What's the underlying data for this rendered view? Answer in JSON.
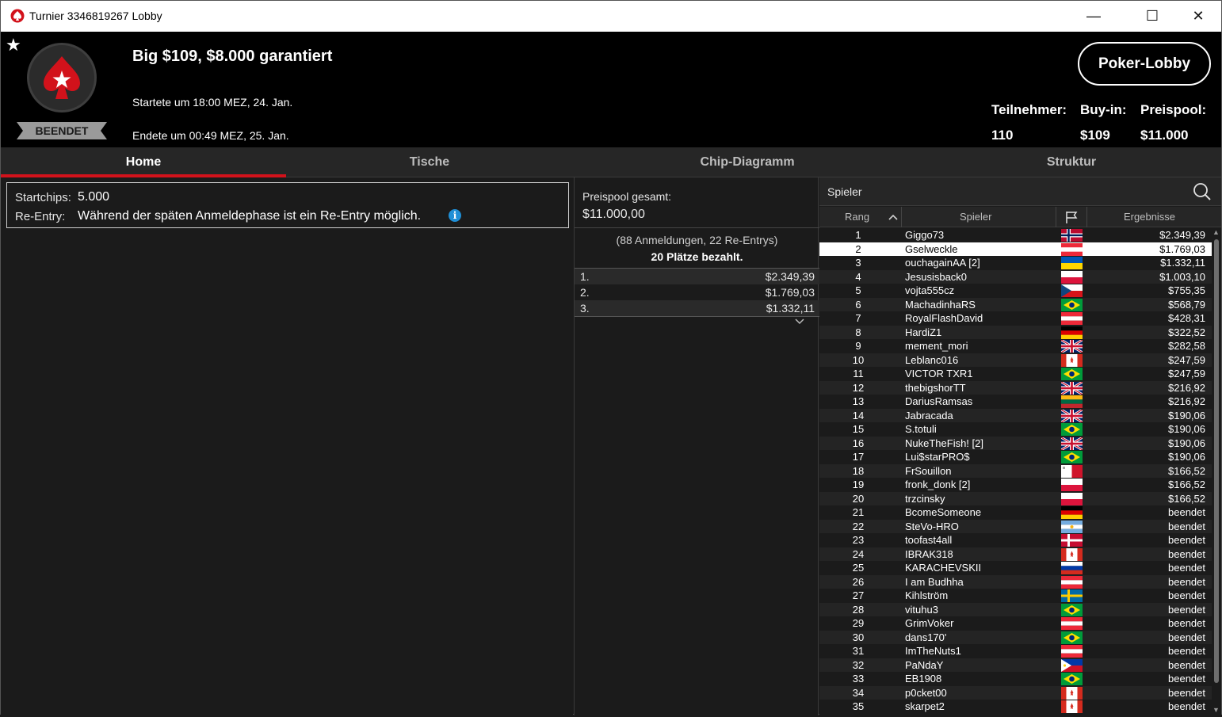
{
  "window": {
    "title": "Turnier 3346819267 Lobby",
    "minimize": "—",
    "maximize": "☐",
    "close": "✕"
  },
  "header": {
    "favorite_icon": "star-icon",
    "status_badge": "BEENDET",
    "tournament_name": "Big $109, $8.000 garantiert",
    "started": "Startete um 18:00 MEZ, 24. Jan.",
    "ended": "Endete um 00:49 MEZ, 25. Jan.",
    "lobby_button": "Poker-Lobby",
    "stats": {
      "participants_label": "Teilnehmer:",
      "participants_value": "110",
      "buyin_label": "Buy-in:",
      "buyin_value": "$109",
      "prizepool_label": "Preispool:",
      "prizepool_value": "$11.000"
    },
    "accent_color": "#d2121b"
  },
  "tabs": [
    "Home",
    "Tische",
    "Chip-Diagramm",
    "Struktur"
  ],
  "active_tab": "Home",
  "info": {
    "startchips_label": "Startchips:",
    "startchips_value": "5.000",
    "reentry_label": "Re-Entry:",
    "reentry_value": "Während der späten Anmeldephase ist ein Re-Entry möglich."
  },
  "prizepool_panel": {
    "label": "Preispool gesamt:",
    "value": "$11.000,00",
    "registrations": "(88 Anmeldungen, 22 Re-Entrys)",
    "places_paid": "20 Plätze bezahlt.",
    "payouts": [
      {
        "place": "1.",
        "amount": "$2.349,39"
      },
      {
        "place": "2.",
        "amount": "$1.769,03"
      },
      {
        "place": "3.",
        "amount": "$1.332,11"
      }
    ]
  },
  "players_panel": {
    "search_placeholder": "Spieler",
    "columns": {
      "rank": "Rang",
      "player": "Spieler",
      "results": "Ergebnisse"
    },
    "selected_rank": "2",
    "rows": [
      {
        "rank": "1",
        "name": "Giggo73",
        "flag": "norway",
        "result": "$2.349,39"
      },
      {
        "rank": "2",
        "name": "Gselweckle",
        "flag": "austria",
        "result": "$1.769,03"
      },
      {
        "rank": "3",
        "name": "ouchagainAA [2]",
        "flag": "ukraine",
        "result": "$1.332,11"
      },
      {
        "rank": "4",
        "name": "Jesusisback0",
        "flag": "poland",
        "result": "$1.003,10"
      },
      {
        "rank": "5",
        "name": "vojta555cz",
        "flag": "czech",
        "result": "$755,35"
      },
      {
        "rank": "6",
        "name": "MachadinhaRS",
        "flag": "brazil",
        "result": "$568,79"
      },
      {
        "rank": "7",
        "name": "RoyalFlashDavid",
        "flag": "austria",
        "result": "$428,31"
      },
      {
        "rank": "8",
        "name": "HardiZ1",
        "flag": "germany",
        "result": "$322,52"
      },
      {
        "rank": "9",
        "name": "mement_mori",
        "flag": "uk",
        "result": "$282,58"
      },
      {
        "rank": "10",
        "name": "Leblanc016",
        "flag": "canada",
        "result": "$247,59"
      },
      {
        "rank": "11",
        "name": "VICTOR TXR1",
        "flag": "brazil",
        "result": "$247,59"
      },
      {
        "rank": "12",
        "name": "thebigshorTT",
        "flag": "uk",
        "result": "$216,92"
      },
      {
        "rank": "13",
        "name": "DariusRamsas",
        "flag": "lithuania",
        "result": "$216,92"
      },
      {
        "rank": "14",
        "name": "Jabracada",
        "flag": "uk",
        "result": "$190,06"
      },
      {
        "rank": "15",
        "name": "S.totuli",
        "flag": "brazil",
        "result": "$190,06"
      },
      {
        "rank": "16",
        "name": "NukeTheFish! [2]",
        "flag": "uk",
        "result": "$190,06"
      },
      {
        "rank": "17",
        "name": "Lui$starPRO$",
        "flag": "brazil",
        "result": "$190,06"
      },
      {
        "rank": "18",
        "name": "FrSouillon",
        "flag": "malta",
        "result": "$166,52"
      },
      {
        "rank": "19",
        "name": "fronk_donk [2]",
        "flag": "poland",
        "result": "$166,52"
      },
      {
        "rank": "20",
        "name": "trzcinsky",
        "flag": "poland",
        "result": "$166,52"
      },
      {
        "rank": "21",
        "name": "BcomeSomeone",
        "flag": "germany",
        "result": "beendet"
      },
      {
        "rank": "22",
        "name": "SteVo-HRO",
        "flag": "argentina",
        "result": "beendet"
      },
      {
        "rank": "23",
        "name": "toofast4all",
        "flag": "denmark",
        "result": "beendet"
      },
      {
        "rank": "24",
        "name": "IBRAK318",
        "flag": "canada",
        "result": "beendet"
      },
      {
        "rank": "25",
        "name": "KARACHEVSKII",
        "flag": "russia",
        "result": "beendet"
      },
      {
        "rank": "26",
        "name": "I am Budhha",
        "flag": "austria",
        "result": "beendet"
      },
      {
        "rank": "27",
        "name": "Kihlström",
        "flag": "sweden",
        "result": "beendet"
      },
      {
        "rank": "28",
        "name": "vituhu3",
        "flag": "brazil",
        "result": "beendet"
      },
      {
        "rank": "29",
        "name": "GrimVoker",
        "flag": "austria",
        "result": "beendet"
      },
      {
        "rank": "30",
        "name": "dans170'",
        "flag": "brazil",
        "result": "beendet"
      },
      {
        "rank": "31",
        "name": "ImTheNuts1",
        "flag": "austria",
        "result": "beendet"
      },
      {
        "rank": "32",
        "name": "PaNdaY",
        "flag": "philippines",
        "result": "beendet"
      },
      {
        "rank": "33",
        "name": "EB1908",
        "flag": "brazil",
        "result": "beendet"
      },
      {
        "rank": "34",
        "name": "p0cket00",
        "flag": "canada",
        "result": "beendet"
      },
      {
        "rank": "35",
        "name": "skarpet2",
        "flag": "canada",
        "result": "beendet"
      }
    ]
  }
}
